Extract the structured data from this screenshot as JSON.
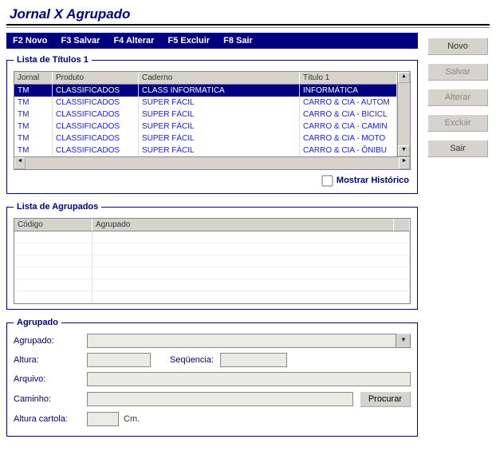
{
  "title": "Jornal X Agrupado",
  "menubar": {
    "novo": "F2 Novo",
    "salvar": "F3 Salvar",
    "alterar": "F4 Alterar",
    "excluir": "F5 Excluir",
    "sair": "F8 Sair"
  },
  "buttons": {
    "novo": "Novo",
    "salvar": "Salvar",
    "alterar": "Alterar",
    "excluir": "Excluir",
    "sair": "Sair",
    "procurar": "Procurar"
  },
  "titulos": {
    "legend": "Lista de Títulos 1",
    "columns": {
      "jornal": "Jornal",
      "produto": "Produto",
      "caderno": "Caderno",
      "titulo": "Título 1"
    },
    "rows": [
      {
        "jornal": "TM",
        "produto": "CLASSIFICADOS",
        "caderno": "CLASS INFORMATICA",
        "titulo": "INFORMÁTICA"
      },
      {
        "jornal": "TM",
        "produto": "CLASSIFICADOS",
        "caderno": "SUPER FÁCIL",
        "titulo": "CARRO & CIA - AUTOM"
      },
      {
        "jornal": "TM",
        "produto": "CLASSIFICADOS",
        "caderno": "SUPER FÁCIL",
        "titulo": "CARRO & CIA - BICICL"
      },
      {
        "jornal": "TM",
        "produto": "CLASSIFICADOS",
        "caderno": "SUPER FÁCIL",
        "titulo": "CARRO & CIA - CAMIN"
      },
      {
        "jornal": "TM",
        "produto": "CLASSIFICADOS",
        "caderno": "SUPER FÁCIL",
        "titulo": "CARRO & CIA - MOTO"
      },
      {
        "jornal": "TM",
        "produto": "CLASSIFICADOS",
        "caderno": "SUPER FÁCIL",
        "titulo": "CARRO & CIA - ÔNIBU"
      }
    ],
    "historico_label": "Mostrar Histórico"
  },
  "agrupados": {
    "legend": "Lista de Agrupados",
    "columns": {
      "codigo": "Código",
      "agrupado": "Agrupado"
    }
  },
  "form": {
    "legend": "Agrupado",
    "labels": {
      "agrupado": "Agrupado:",
      "altura": "Altura:",
      "sequencia": "Seqüencia:",
      "arquivo": "Arquivo:",
      "caminho": "Caminho:",
      "altura_cartola": "Altura cartola:"
    },
    "unit_cm": "Cm.",
    "values": {
      "agrupado": "",
      "altura": "",
      "sequencia": "",
      "arquivo": "",
      "caminho": "",
      "altura_cartola": ""
    }
  }
}
